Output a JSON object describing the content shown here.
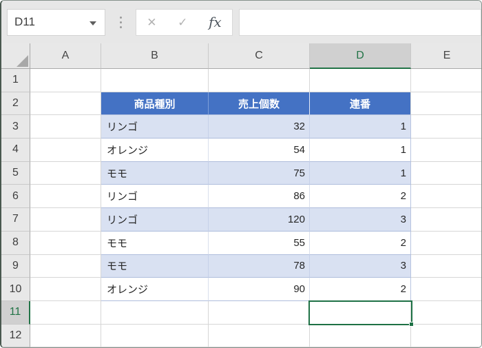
{
  "formula_bar": {
    "name_box_value": "D11",
    "cancel_icon": "✕",
    "confirm_icon": "✓",
    "function_icon": "fx",
    "input_value": ""
  },
  "sheet": {
    "column_headers": [
      "A",
      "B",
      "C",
      "D",
      "E"
    ],
    "row_headers": [
      "1",
      "2",
      "3",
      "4",
      "5",
      "6",
      "7",
      "8",
      "9",
      "10",
      "11",
      "12"
    ],
    "selected_cell": "D11",
    "selected_column": "D",
    "selected_row": "11"
  },
  "table": {
    "headers": {
      "product": "商品種別",
      "sales": "売上個数",
      "serial": "連番"
    },
    "rows": [
      {
        "product": "リンゴ",
        "sales": "32",
        "serial": "1"
      },
      {
        "product": "オレンジ",
        "sales": "54",
        "serial": "1"
      },
      {
        "product": "モモ",
        "sales": "75",
        "serial": "1"
      },
      {
        "product": "リンゴ",
        "sales": "86",
        "serial": "2"
      },
      {
        "product": "リンゴ",
        "sales": "120",
        "serial": "3"
      },
      {
        "product": "モモ",
        "sales": "55",
        "serial": "2"
      },
      {
        "product": "モモ",
        "sales": "78",
        "serial": "3"
      },
      {
        "product": "オレンジ",
        "sales": "90",
        "serial": "2"
      }
    ]
  },
  "colors": {
    "table_header_fill": "#4472C4",
    "table_band_fill": "#D9E1F2",
    "selection_green": "#217346",
    "header_gray": "#E8E8E8",
    "selected_header_gray": "#D0D0D0"
  }
}
